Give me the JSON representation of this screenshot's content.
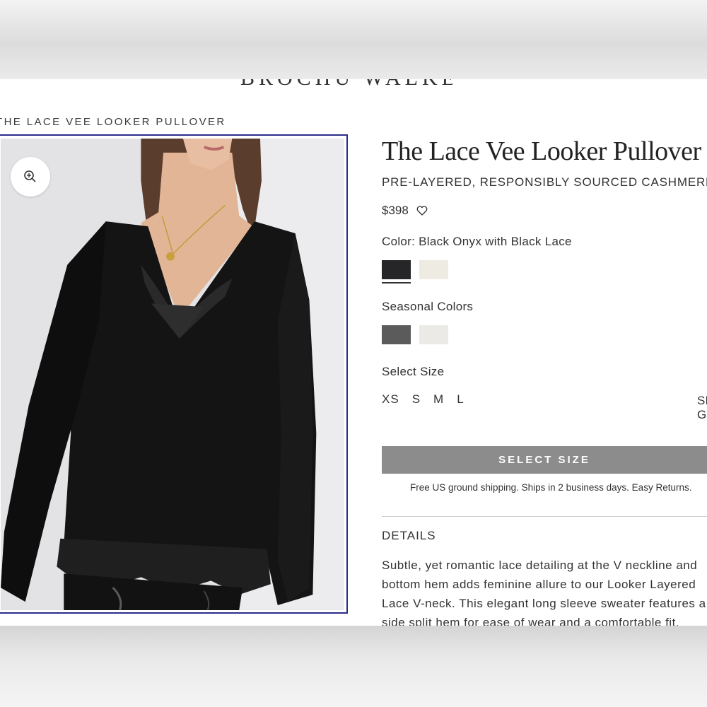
{
  "brand": {
    "name": "BROCHU WALKER"
  },
  "breadcrumb": {
    "text": "THE LACE VEE LOOKER PULLOVER"
  },
  "image": {
    "zoom_icon": "zoom-in-icon"
  },
  "product": {
    "title": "The Lace Vee Looker Pullover",
    "subtitle": "PRE-LAYERED, RESPONSIBLY SOURCED CASHMERE",
    "price": "$398",
    "wishlist_icon": "heart-icon"
  },
  "colors": {
    "label": "Color: Black Onyx with Black Lace",
    "swatches": [
      {
        "name": "Black Onyx with Black Lace",
        "hex": "#262527",
        "selected": true
      },
      {
        "name": "Ivory",
        "hex": "#eeebe3",
        "selected": false
      }
    ]
  },
  "seasonal": {
    "label": "Seasonal Colors",
    "swatches": [
      {
        "hex": "#5b5b5c"
      },
      {
        "hex": "#eceae6"
      }
    ]
  },
  "size": {
    "label": "Select Size",
    "options": [
      "XS",
      "S",
      "M",
      "L"
    ],
    "guide": "SIZE GUIDE"
  },
  "cta": {
    "label": "SELECT SIZE",
    "color": "#8c8c8c"
  },
  "shipping": {
    "text": "Free US ground shipping. Ships in 2 business days. Easy Returns."
  },
  "details": {
    "heading": "DETAILS",
    "lines": [
      "Subtle, yet romantic lace detailing at the V neckline and",
      "bottom hem adds feminine allure to our Looker Layered",
      "Lace V-neck. This elegant long sleeve sweater features a",
      "side split hem for ease of wear and a comfortable fit."
    ]
  },
  "theme": {
    "frame_border": "#2b2c8c"
  }
}
